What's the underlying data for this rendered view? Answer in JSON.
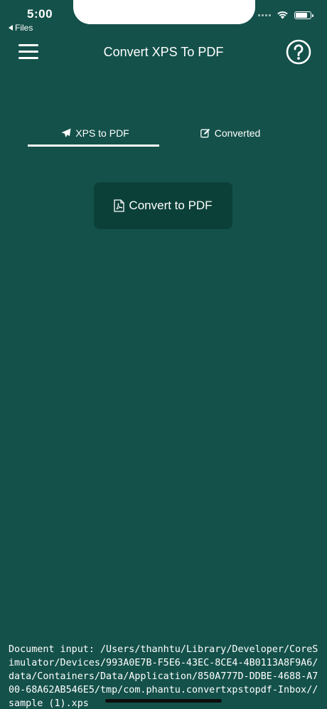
{
  "status_bar": {
    "time": "5:00",
    "back_label": "Files",
    "battery_level": 0.85
  },
  "nav": {
    "title": "Convert XPS To PDF"
  },
  "tabs": [
    {
      "label": "XPS to PDF",
      "icon": "paper-plane-icon",
      "active": true
    },
    {
      "label": "Converted",
      "icon": "edit-icon",
      "active": false
    }
  ],
  "convert_button": {
    "label": "Convert to PDF",
    "icon": "pdf-file-icon"
  },
  "document": {
    "path_text": "Document input: /Users/thanhtu/Library/Developer/CoreSimulator/Devices/993A0E7B-F5E6-43EC-8CE4-4B0113A8F9A6/data/Containers/Data/Application/850A777D-DDBE-4688-A700-68A62AB546E5/tmp/com.phantu.convertxpstopdf-Inbox//sample (1).xps"
  },
  "colors": {
    "background": "#14514a",
    "button": "#0b4038",
    "text": "#ffffff"
  }
}
